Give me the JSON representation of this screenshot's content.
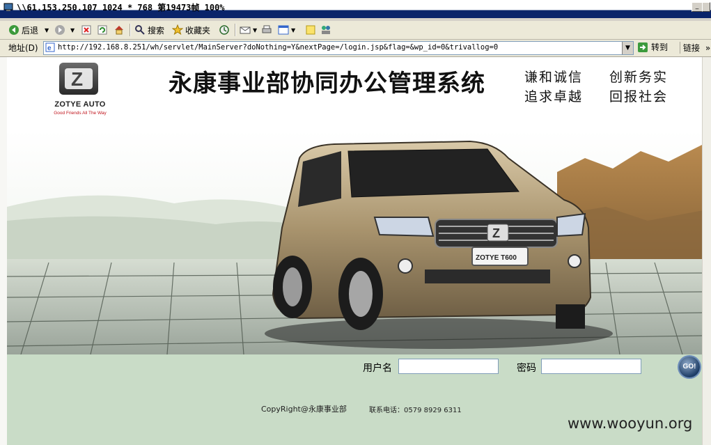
{
  "window": {
    "title": "\\\\61.153.250.107 1024 * 768 第19473帧 100%",
    "controls": {
      "minimize": "_"
    }
  },
  "toolbar": {
    "back_label": "后退",
    "search_label": "搜索",
    "favorites_label": "收藏夹"
  },
  "address_bar": {
    "label": "地址(D)",
    "url": "http://192.168.8.251/wh/servlet/MainServer?doNothing=Y&nextPage=/login.jsp&flag=&wp_id=0&trivallog=0",
    "go_label": "转到",
    "links_label": "链接",
    "links_more": "»"
  },
  "page": {
    "logo": {
      "brand": "ZOTYE AUTO",
      "tagline": "Good Friends All The Way",
      "emblem_letter": "Z"
    },
    "title": "永康事业部协同办公管理系统",
    "slogans": [
      "谦和诚信",
      "创新务实",
      "追求卓越",
      "回报社会"
    ],
    "banner": {
      "plate_text": "ZOTYE T600",
      "grille_letter": "Z"
    },
    "login": {
      "username_label": "用户名",
      "username_value": "",
      "password_label": "密码",
      "password_value": "",
      "go_label": "GO!"
    },
    "footer": {
      "copyright": "CopyRight@永康事业部",
      "phone": "联系电话：0579 8929 6311"
    }
  },
  "watermark": "www.wooyun.org",
  "colors": {
    "page_bg": "#c9dcc7",
    "titlebar": "#0a246a",
    "tagline_red": "#c0131b"
  }
}
